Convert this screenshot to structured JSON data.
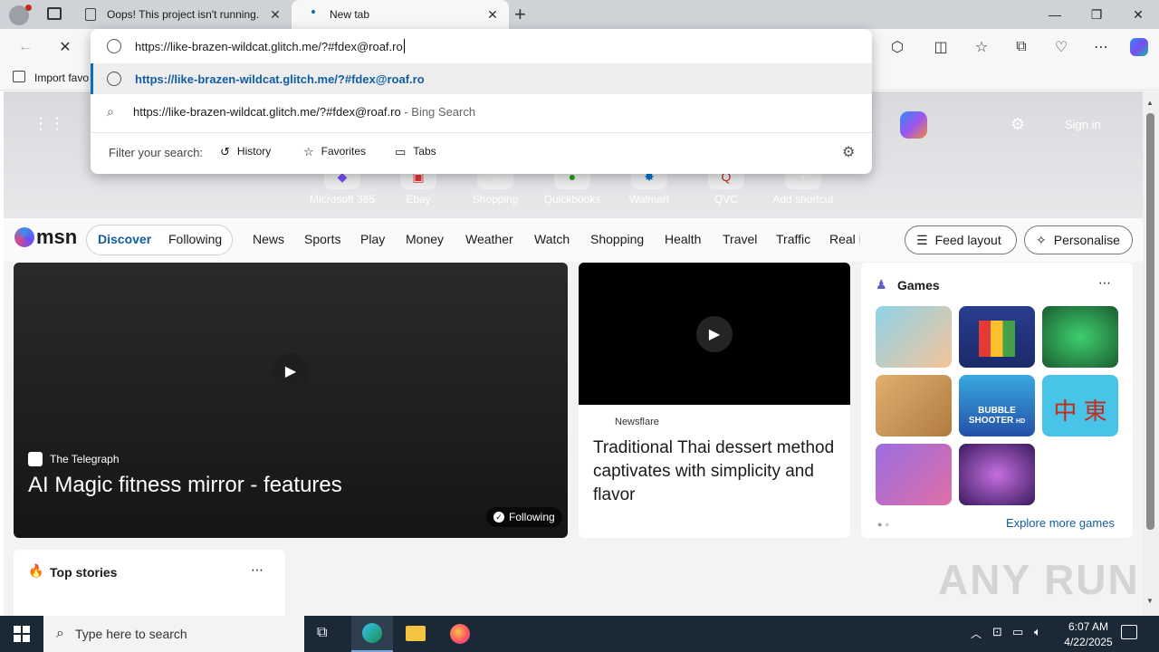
{
  "browser": {
    "tabs": [
      {
        "title": "Oops! This project isn't running."
      },
      {
        "title": "New tab"
      }
    ],
    "address_value": "https://like-brazen-wildcat.glitch.me/?#fdex@roaf.ro",
    "favorites_bar": {
      "import_label": "Import favo"
    }
  },
  "omnibox": {
    "suggestions": [
      {
        "url": "https://like-brazen-wildcat.glitch.me/?#fdex@roaf.ro"
      },
      {
        "text": "https://like-brazen-wildcat.glitch.me/?#fdex@roaf.ro",
        "suffix": " - Bing Search"
      }
    ],
    "filter_label": "Filter your search:",
    "filters": [
      "History",
      "Favorites",
      "Tabs"
    ]
  },
  "newtab": {
    "sign_in": "Sign in",
    "shortcuts": [
      "Microsoft 365",
      "Ebay",
      "Shopping",
      "Quickbooks",
      "Walmart",
      "QVC",
      "Add shortcut"
    ]
  },
  "msn": {
    "logo": "msn",
    "tabs": {
      "discover": "Discover",
      "following": "Following"
    },
    "nav": [
      "News",
      "Sports",
      "Play",
      "Money",
      "Weather",
      "Watch",
      "Shopping",
      "Health",
      "Travel",
      "Traffic",
      "Real E"
    ],
    "feed_layout": "Feed layout",
    "personalise": "Personalise",
    "hero_card": {
      "source": "The Telegraph",
      "title": "AI Magic fitness mirror - features",
      "badge": "Following"
    },
    "story_card": {
      "source": "Newsflare",
      "title": "Traditional Thai dessert method captivates with simplicity and flavor"
    },
    "games": {
      "title": "Games",
      "explore": "Explore more games",
      "tile_label": "BUBBLE SHOOTER",
      "tile_label_sub": "HD",
      "mahjong_glyphs": "中 東"
    },
    "top_stories": {
      "title": "Top stories"
    }
  },
  "watermark": "ANY RUN",
  "taskbar": {
    "search_placeholder": "Type here to search",
    "time": "6:07 AM",
    "date": "4/22/2025"
  },
  "colors": {
    "accent": "#0f6cbd",
    "taskbar": "#1b2937",
    "link": "#115ea3"
  }
}
